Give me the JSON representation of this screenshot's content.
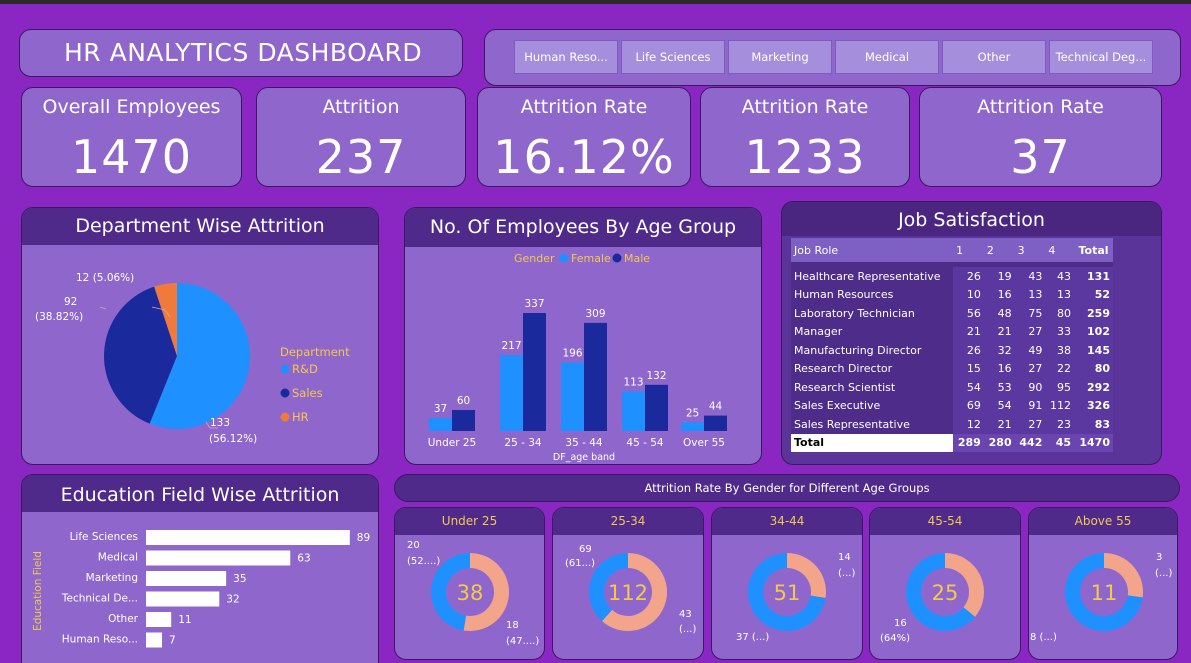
{
  "dashboard": {
    "title": "HR ANALYTICS DASHBOARD"
  },
  "slicer": {
    "items": [
      "Human Reso...",
      "Life Sciences",
      "Marketing",
      "Medical",
      "Other",
      "Technical Deg..."
    ]
  },
  "kpis": [
    {
      "label": "Overall Employees",
      "value": "1470"
    },
    {
      "label": "Attrition",
      "value": "237"
    },
    {
      "label": "Attrition Rate",
      "value": "16.12%"
    },
    {
      "label": "Attrition Rate",
      "value": "1233"
    },
    {
      "label": "Attrition Rate",
      "value": "37"
    }
  ],
  "dept": {
    "title": "Department Wise Attrition",
    "legend_title": "Department",
    "labels": {
      "hr": "12 (5.06%)",
      "sales_a": "92",
      "sales_b": "(38.82%)",
      "rd_a": "133",
      "rd_b": "(56.12%)"
    }
  },
  "age": {
    "title": "No. Of Employees By Age Group",
    "legend": {
      "title": "Gender",
      "female": "Female",
      "male": "Male"
    },
    "xlabel": "DF_age band"
  },
  "job": {
    "title": "Job Satisfaction",
    "headers": [
      "Job Role",
      "1",
      "2",
      "3",
      "4",
      "Total"
    ],
    "rows": [
      [
        "Healthcare Representative",
        "26",
        "19",
        "43",
        "43",
        "131"
      ],
      [
        "Human Resources",
        "10",
        "16",
        "13",
        "13",
        "52"
      ],
      [
        "Laboratory Technician",
        "56",
        "48",
        "75",
        "80",
        "259"
      ],
      [
        "Manager",
        "21",
        "21",
        "27",
        "33",
        "102"
      ],
      [
        "Manufacturing Director",
        "26",
        "32",
        "49",
        "38",
        "145"
      ],
      [
        "Research Director",
        "15",
        "16",
        "27",
        "22",
        "80"
      ],
      [
        "Research Scientist",
        "54",
        "53",
        "90",
        "95",
        "292"
      ],
      [
        "Sales Executive",
        "69",
        "54",
        "91",
        "112",
        "326"
      ],
      [
        "Sales Representative",
        "12",
        "21",
        "27",
        "23",
        "83"
      ]
    ],
    "total": [
      "Total",
      "289",
      "280",
      "442",
      "45",
      "1470"
    ]
  },
  "edu": {
    "title": "Education Field Wise Attrition",
    "axis_label": "Education Field"
  },
  "gender_age": {
    "title": "Attrition Rate By Gender for Different Age Groups",
    "groups": [
      {
        "title": "Under 25",
        "center": "38",
        "label_top": [
          "20",
          "(52....)"
        ],
        "label_bottom": [
          "18",
          "(47....)"
        ]
      },
      {
        "title": "25-34",
        "center": "112",
        "label_top": [
          "69",
          "(61...)"
        ],
        "label_bottom": [
          "43",
          "(...)"
        ]
      },
      {
        "title": "34-44",
        "center": "51",
        "label_top": [
          "14",
          "(...)"
        ],
        "label_bottom": [
          "37 (...)",
          ""
        ]
      },
      {
        "title": "45-54",
        "center": "25",
        "label_top": [
          "",
          ""
        ],
        "label_bottom": [
          "16",
          "(64%)"
        ]
      },
      {
        "title": "Above 55",
        "center": "11",
        "label_top": [
          "3",
          "(...)"
        ],
        "label_bottom": [
          "8 (...)",
          ""
        ]
      }
    ]
  },
  "colors": {
    "background": "#8a27c2",
    "panel": "#8f67cc",
    "header": "#4f2a8a",
    "light_blue": "#1e90ff",
    "dark_blue": "#1a2a9c",
    "orange": "#f07a3c",
    "peach": "#f2a58a",
    "gold": "#f2c94c"
  },
  "chart_data": [
    {
      "type": "pie",
      "title": "Department Wise Attrition",
      "legend_title": "Department",
      "categories": [
        "R&D",
        "Sales",
        "HR"
      ],
      "values": [
        133,
        92,
        12
      ],
      "percent": [
        56.12,
        38.82,
        5.06
      ],
      "colors": [
        "#1e90ff",
        "#1a2a9c",
        "#f07a3c"
      ]
    },
    {
      "type": "bar",
      "title": "No. Of Employees By Age Group",
      "xlabel": "DF_age band",
      "categories": [
        "Under 25",
        "25 - 34",
        "35 - 44",
        "45 - 54",
        "Over 55"
      ],
      "series": [
        {
          "name": "Female",
          "values": [
            37,
            217,
            196,
            113,
            25
          ]
        },
        {
          "name": "Male",
          "values": [
            60,
            337,
            309,
            132,
            44
          ]
        }
      ]
    },
    {
      "type": "bar",
      "title": "Education Field Wise Attrition",
      "ylabel": "Education Field",
      "orientation": "horizontal",
      "categories": [
        "Life Sciences",
        "Medical",
        "Marketing",
        "Technical De...",
        "Other",
        "Human Reso..."
      ],
      "values": [
        89,
        63,
        35,
        32,
        11,
        7
      ],
      "value_labels": [
        "89",
        "63",
        "35",
        "32",
        "11",
        "7"
      ]
    },
    {
      "type": "pie",
      "title": "Attrition Rate By Gender for Different Age Groups",
      "donut": true,
      "groups": [
        "Under 25",
        "25-34",
        "34-44",
        "45-54",
        "Above 55"
      ],
      "series": [
        {
          "values": [
            20,
            69,
            14,
            9,
            3
          ]
        },
        {
          "values": [
            18,
            43,
            37,
            16,
            8
          ]
        }
      ],
      "totals": [
        38,
        112,
        51,
        25,
        11
      ]
    }
  ]
}
